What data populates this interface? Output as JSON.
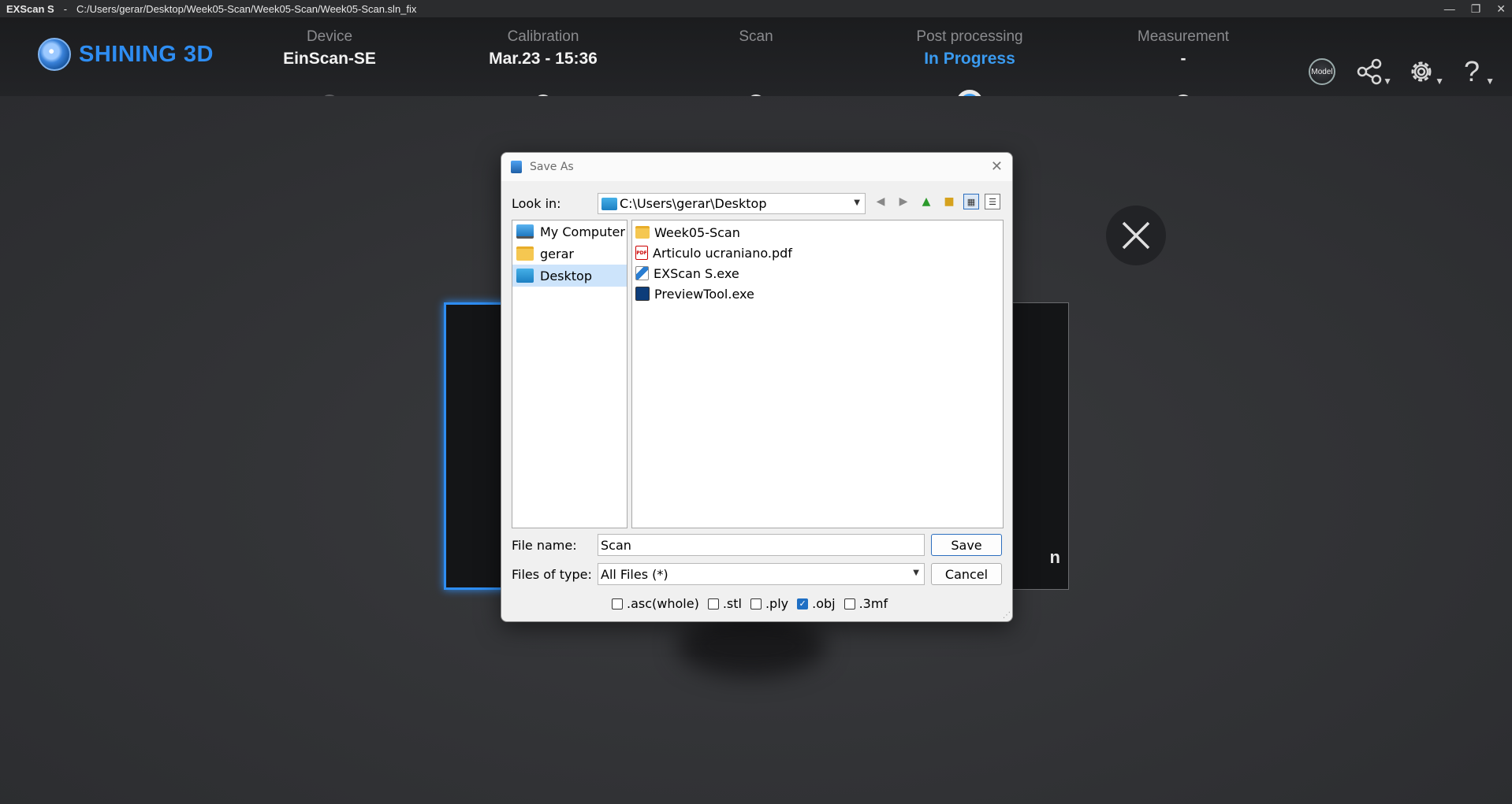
{
  "window": {
    "app_name": "EXScan S",
    "separator": "-",
    "file_path": "C:/Users/gerar/Desktop/Week05-Scan/Week05-Scan/Week05-Scan.sln_fix",
    "minimize": "—",
    "restore": "❐",
    "close": "✕"
  },
  "brand": {
    "name": "SHINING 3D",
    "color": "#2e8df2"
  },
  "steps": [
    {
      "label": "Device",
      "value": "EinScan-SE",
      "state": "done"
    },
    {
      "label": "Calibration",
      "value": "Mar.23 - 15:36",
      "state": "pending"
    },
    {
      "label": "Scan",
      "value": "",
      "state": "pending"
    },
    {
      "label": "Post processing",
      "value": "In Progress",
      "state": "active"
    },
    {
      "label": "Measurement",
      "value": "-",
      "state": "pending"
    }
  ],
  "toolbar": {
    "model_icon_text": "Model"
  },
  "background": {
    "right_card_text": "n"
  },
  "dialog": {
    "title": "Save As",
    "close": "✕",
    "look_in_label": "Look in:",
    "look_in_value": "C:\\Users\\gerar\\Desktop",
    "sidebar": [
      {
        "label": "My Computer",
        "icon": "computer-icon"
      },
      {
        "label": "gerar",
        "icon": "folder-icon"
      },
      {
        "label": "Desktop",
        "icon": "desktop-icon",
        "selected": true
      }
    ],
    "files": [
      {
        "name": "Week05-Scan",
        "icon": "folder-icon"
      },
      {
        "name": "Articulo ucraniano.pdf",
        "icon": "pdf-icon"
      },
      {
        "name": "EXScan S.exe",
        "icon": "exe-icon"
      },
      {
        "name": "PreviewTool.exe",
        "icon": "exe-icon"
      }
    ],
    "file_name_label": "File name:",
    "file_name_value": "Scan",
    "files_of_type_label": "Files of type:",
    "files_of_type_value": "All Files (*)",
    "save_label": "Save",
    "cancel_label": "Cancel",
    "formats": [
      {
        "label": ".asc(whole)",
        "checked": false
      },
      {
        "label": ".stl",
        "checked": false
      },
      {
        "label": ".ply",
        "checked": false
      },
      {
        "label": ".obj",
        "checked": true
      },
      {
        "label": ".3mf",
        "checked": false
      }
    ]
  }
}
